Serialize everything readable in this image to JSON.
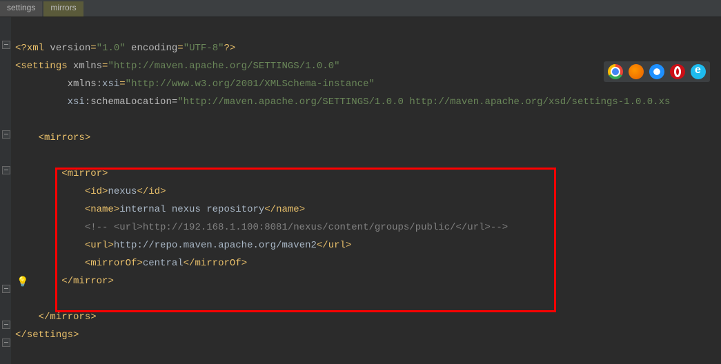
{
  "breadcrumb": {
    "items": [
      {
        "label": "settings"
      },
      {
        "label": "mirrors"
      }
    ]
  },
  "code": {
    "l1_a": "<?",
    "l1_b": "xml ",
    "l1_c": "version",
    "l1_d": "=",
    "l1_e": "\"1.0\"",
    "l1_f": " encoding",
    "l1_g": "=",
    "l1_h": "\"UTF-8\"",
    "l1_i": "?>",
    "l2_a": "<",
    "l2_b": "settings ",
    "l2_c": "xmlns",
    "l2_d": "=",
    "l2_e": "\"http://maven.apache.org/SETTINGS/1.0.0\"",
    "l3_a": "         ",
    "l3_b": "xmlns:",
    "l3_c": "xsi",
    "l3_d": "=",
    "l3_e": "\"http://www.w3.org/2001/XMLSchema-instance\"",
    "l4_a": "         ",
    "l4_b": "xsi",
    "l4_c": ":schemaLocation=",
    "l4_d": "\"http://maven.apache.org/SETTINGS/1.0.0 http://maven.apache.org/xsd/settings-1.0.0.xs",
    "l6_a": "    <",
    "l6_b": "mirrors",
    "l6_c": ">",
    "l8_a": "        <",
    "l8_b": "mirror",
    "l8_c": ">",
    "l9_a": "            <",
    "l9_b": "id",
    "l9_c": ">",
    "l9_d": "nexus",
    "l9_e": "</",
    "l9_f": "id",
    "l9_g": ">",
    "l10_a": "            <",
    "l10_b": "name",
    "l10_c": ">",
    "l10_d": "internal nexus repository",
    "l10_e": "</",
    "l10_f": "name",
    "l10_g": ">",
    "l11": "            <!-- <url>http://192.168.1.100:8081/nexus/content/groups/public/</url>-->",
    "l12_a": "            <",
    "l12_b": "url",
    "l12_c": ">",
    "l12_d": "http://repo.maven.apache.org/maven2",
    "l12_e": "</",
    "l12_f": "url",
    "l12_g": ">",
    "l13_a": "            <",
    "l13_b": "mirrorOf",
    "l13_c": ">",
    "l13_d": "central",
    "l13_e": "</",
    "l13_f": "mirrorOf",
    "l13_g": ">",
    "l14_a": "        </",
    "l14_b": "mirror",
    "l14_c": ">",
    "l16_a": "    </",
    "l16_b": "mirrors",
    "l16_c": ">",
    "l17_a": "</",
    "l17_b": "settings",
    "l17_c": ">"
  },
  "browsers": [
    "chrome",
    "firefox",
    "safari",
    "opera",
    "ie"
  ]
}
